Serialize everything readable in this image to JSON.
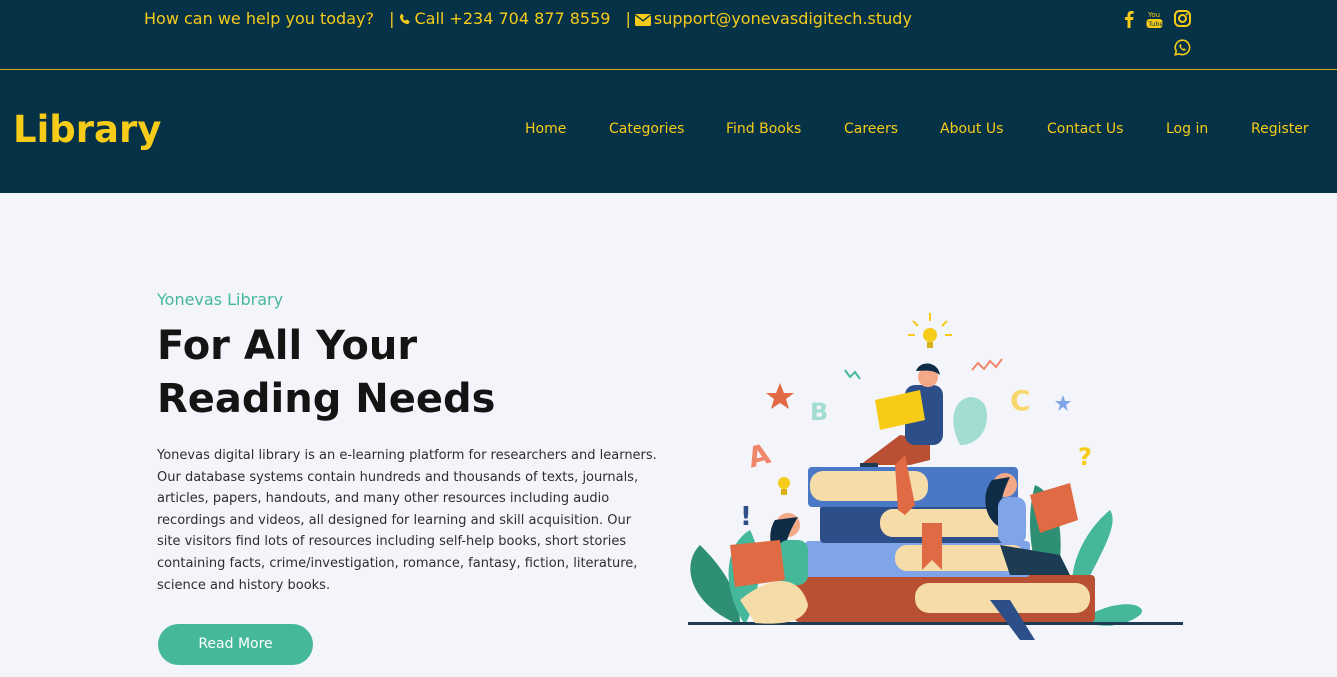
{
  "topbar": {
    "help_text": "How can we help you today?",
    "separator": "|",
    "phone": "Call +234 704 877 8559",
    "separator2": "|",
    "email": "support@yonevasdigitech.study",
    "icons": [
      "phone-icon",
      "envelope-icon",
      "facebook-icon",
      "youtube-icon",
      "instagram-icon",
      "whatsapp-icon"
    ]
  },
  "nav": {
    "logo": "Library",
    "items": [
      {
        "label": "Home"
      },
      {
        "label": "Categories"
      },
      {
        "label": "Find Books"
      },
      {
        "label": "Careers"
      },
      {
        "label": "About Us"
      },
      {
        "label": "Contact Us"
      },
      {
        "label": "Log in"
      },
      {
        "label": "Register"
      }
    ]
  },
  "hero": {
    "subtitle": "Yonevas Library",
    "title_line1": "For All Your",
    "title_line2": "Reading Needs",
    "body": "Yonevas digital library is an e-learning platform for researchers and learners. Our database systems contain hundreds and thousands of texts, journals, articles, papers, handouts, and many other resources including audio recordings and videos, all designed for learning and skill acquisition. Our site visitors find lots of resources including self-help books, short stories containing facts, crime/investigation, romance, fantasy, fiction, literature, science and history books.",
    "button": "Read More",
    "illustration_letters": [
      "A",
      "B",
      "C",
      "?",
      "!"
    ]
  },
  "colors": {
    "navy": "#063247",
    "gold": "#f6cc19",
    "teal": "#45b89b",
    "background": "#f4f5fa"
  }
}
